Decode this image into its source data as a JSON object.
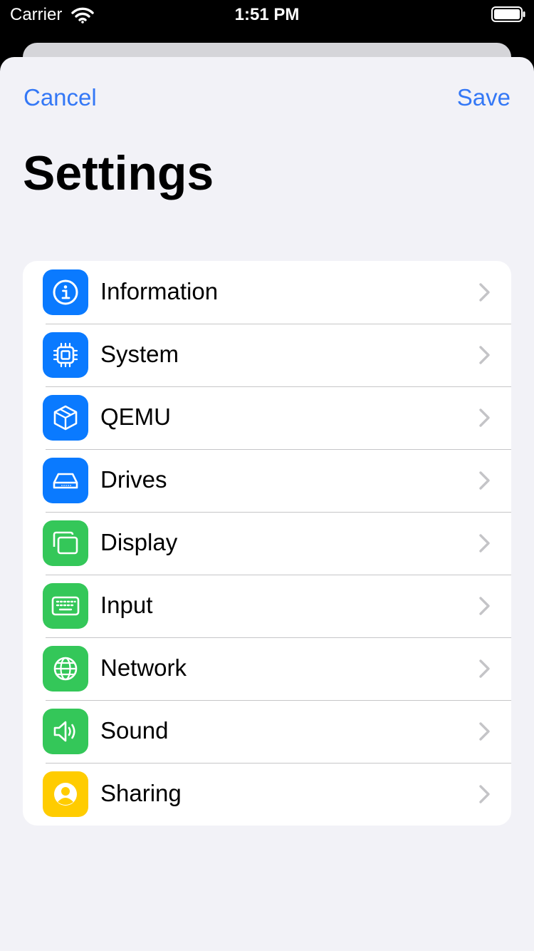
{
  "status_bar": {
    "carrier": "Carrier",
    "time": "1:51 PM"
  },
  "nav": {
    "cancel_label": "Cancel",
    "save_label": "Save",
    "title": "Settings"
  },
  "colors": {
    "accent": "#3478f6",
    "blue_tile": "#0a7aff",
    "green_tile": "#34c759",
    "yellow_tile": "#ffcc00",
    "background": "#f2f2f7",
    "separator": "#c6c6c8",
    "chevron": "#c4c4c7"
  },
  "items": [
    {
      "label": "Information",
      "icon": "info-icon",
      "color": "#0a7aff"
    },
    {
      "label": "System",
      "icon": "cpu-icon",
      "color": "#0a7aff"
    },
    {
      "label": "QEMU",
      "icon": "cube-icon",
      "color": "#0a7aff"
    },
    {
      "label": "Drives",
      "icon": "drive-icon",
      "color": "#0a7aff"
    },
    {
      "label": "Display",
      "icon": "display-icon",
      "color": "#34c759"
    },
    {
      "label": "Input",
      "icon": "keyboard-icon",
      "color": "#34c759"
    },
    {
      "label": "Network",
      "icon": "globe-icon",
      "color": "#34c759"
    },
    {
      "label": "Sound",
      "icon": "speaker-icon",
      "color": "#34c759"
    },
    {
      "label": "Sharing",
      "icon": "person-icon",
      "color": "#ffcc00"
    }
  ]
}
